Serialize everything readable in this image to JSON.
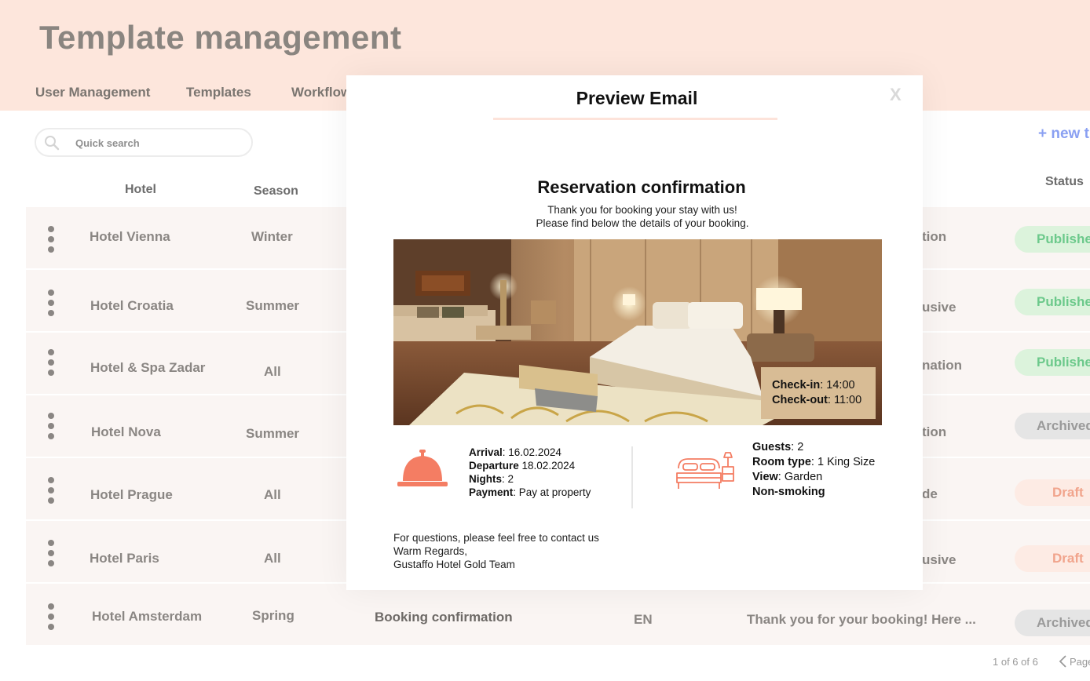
{
  "page": {
    "title": "Template management",
    "nav": [
      "User Management",
      "Templates",
      "Workflow"
    ],
    "search": {
      "placeholder": "Quick search"
    },
    "new_button": "+ new t",
    "columns": {
      "hotel": "Hotel",
      "season": "Season",
      "status": "Status"
    },
    "rows": [
      {
        "hotel": "Hotel  Vienna",
        "season": "Winter",
        "right_text": "tion",
        "status": "Publishe",
        "status_kind": "published"
      },
      {
        "hotel": "Hotel Croatia",
        "season": "Summer",
        "right_text": "usive",
        "status": "Publishe",
        "status_kind": "published"
      },
      {
        "hotel": "Hotel & Spa Zadar",
        "season": "All",
        "right_text": "nation",
        "status": "Publishe",
        "status_kind": "published"
      },
      {
        "hotel": "Hotel Nova",
        "season": "Summer",
        "right_text": "tion",
        "status": "Archived",
        "status_kind": "archived"
      },
      {
        "hotel": "Hotel  Prague",
        "season": "All",
        "right_text": "de",
        "status": "Draft",
        "status_kind": "draft"
      },
      {
        "hotel": "Hotel  Paris",
        "season": "All",
        "right_text": "usive",
        "status": "Draft",
        "status_kind": "draft"
      },
      {
        "hotel": "Hotel  Amsterdam",
        "season": "Spring",
        "template": "Booking confirmation",
        "language": "EN",
        "subject": "Thank you for your booking! Here ...",
        "status": "Archived",
        "status_kind": "archived"
      }
    ],
    "pagination": {
      "text": "1 of 6 of 6",
      "label": "Page"
    }
  },
  "modal": {
    "title": "Preview Email",
    "close": "X",
    "email": {
      "heading": "Reservation confirmation",
      "intro_line1": "Thank you for booking your stay with us!",
      "intro_line2": "Please find below the details of your booking.",
      "checkin_label": "Check-in",
      "checkin_value": ": 14:00",
      "checkout_label": "Check-out",
      "checkout_value": ": 11:00",
      "arrival_label": "Arrival",
      "arrival_value": ": 16.02.2024",
      "departure_label": "Departure",
      "departure_value": " 18.02.2024",
      "nights_label": "Nights",
      "nights_value": ": 2",
      "payment_label": "Payment",
      "payment_value": ": Pay at property",
      "guests_label": "Guests",
      "guests_value": ": 2",
      "roomtype_label": "Room type",
      "roomtype_value": ": 1 King Size",
      "view_label": "View",
      "view_value": ": Garden",
      "nonsmoking_label": "Non-smoking",
      "footer_line1": "For questions, please feel free to contact us",
      "footer_line2": "Warm Regards,",
      "footer_line3": "Gustaffo Hotel Gold Team"
    }
  },
  "colors": {
    "header_band": "#fde6dc",
    "accent_salmon": "#f47d63",
    "published_bg": "#dcf3dc",
    "draft_bg": "#fdebe4",
    "archived_bg": "#e5e5e5",
    "new_button": "#8aa0f2"
  },
  "icons": [
    "search-icon",
    "kebab-menu-icon",
    "close-icon",
    "bell-icon",
    "bed-icon",
    "chevron-left-icon"
  ]
}
